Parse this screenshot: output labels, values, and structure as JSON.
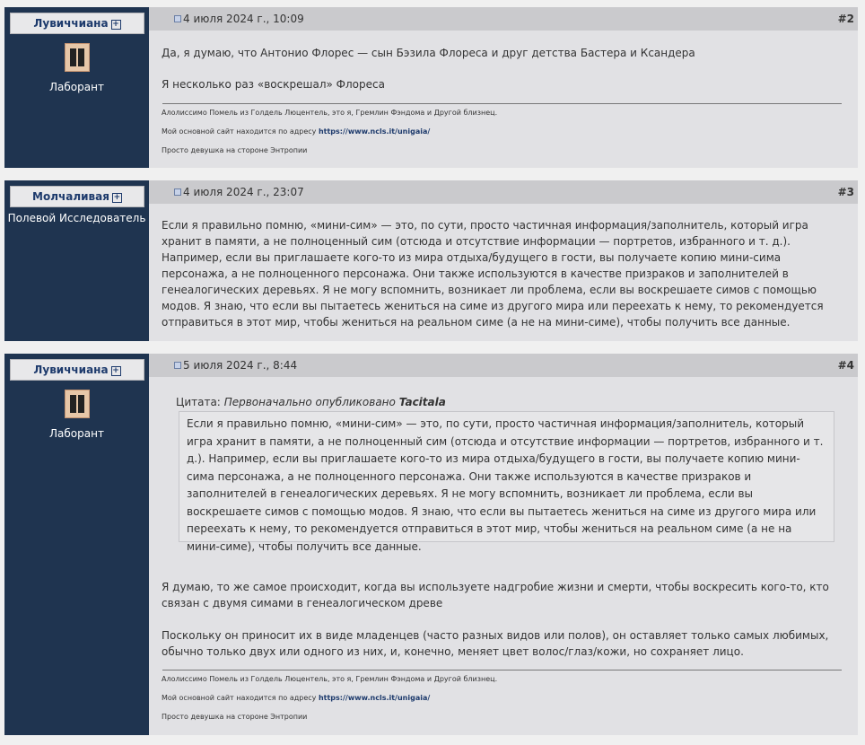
{
  "posts": [
    {
      "user": "Лувиччиана",
      "title": "Лаборант",
      "date": "4 июля 2024 г., 10:09",
      "number": "#2",
      "paragraphs": [
        "Да, я думаю, что Антонио Флорес — сын Бэзила Флореса и друг детства Бастера и Ксандера",
        "Я несколько раз «воскрешал» Флореса"
      ],
      "signature": {
        "line1": "Алолиссимо Помель из Голдель Люцентель, это я, Гремлин Фэндома и Другой близнец.",
        "line2_prefix": "Мой основной сайт находится по адресу",
        "line2_link": "https://www.ncls.it/unigaia/",
        "line3": "Просто девушка на стороне Энтропии"
      }
    },
    {
      "user": "Молчаливая",
      "title": "Полевой Исследователь",
      "date": "4 июля 2024 г., 23:07",
      "number": "#3",
      "paragraphs": [
        "Если я правильно помню, «мини-сим» — это, по сути, просто частичная информация/заполнитель, который игра хранит в памяти, а не полноценный сим (отсюда и отсутствие информации — портретов, избранного и т. д.). Например, если вы приглашаете кого-то из мира отдыха/будущего в гости, вы получаете копию мини-сима персонажа, а не полноценного персонажа. Они также используются в качестве призраков и заполнителей в генеалогических деревьях. Я не могу вспомнить, возникает ли проблема, если вы воскрешаете симов с помощью модов. Я знаю, что если вы пытаетесь жениться на симе из другого мира или переехать к нему, то рекомендуется отправиться в этот мир, чтобы жениться на реальном симе (а не на мини-симе), чтобы получить все данные."
      ]
    },
    {
      "user": "Лувиччиана",
      "title": "Лаборант",
      "date": "5 июля 2024 г., 8:44",
      "number": "#4",
      "quote_prefix": "Цитата:",
      "quote_by": "Первоначально опубликовано",
      "quote_author": "Tacitala",
      "quote_text": "Если я правильно помню, «мини-сим» — это, по сути, просто частичная информация/заполнитель, который игра хранит в памяти, а не полноценный сим (отсюда и отсутствие информации — портретов, избранного и т. д.). Например, если вы приглашаете кого-то из мира отдыха/будущего в гости, вы получаете копию мини-сима персонажа, а не полноценного персонажа. Они также используются в качестве призраков и заполнителей в генеалогических деревьях. Я не могу вспомнить, возникает ли проблема, если вы воскрешаете симов с помощью модов. Я знаю, что если вы пытаетесь жениться на симе из другого мира или переехать к нему, то рекомендуется отправиться в этот мир, чтобы жениться на реальном симе (а не на мини-симе), чтобы получить все данные.",
      "paragraphs": [
        "Я думаю, то же самое происходит, когда вы используете надгробие жизни и смерти, чтобы воскресить кого-то, кто связан с двумя симами в генеалогическом древе",
        "Поскольку он приносит их в виде младенцев (часто разных видов или полов), он оставляет только самых любимых, обычно только двух или одного из них, и, конечно, меняет цвет волос/глаз/кожи, но сохраняет лицо."
      ],
      "signature": {
        "line1": "Алолиссимо Помель из Голдель Люцентель, это я, Гремлин Фэндома и Другой близнец.",
        "line2_prefix": "Мой основной сайт находится по адресу",
        "line2_link": "https://www.ncls.it/unigaia/",
        "line3": "Просто девушка на стороне Энтропии"
      }
    }
  ],
  "icons": [
    "plus-icon",
    "post-icon"
  ],
  "colors": {
    "sidebar": "#1f3450",
    "post_bg": "#e1e1e4",
    "header_bg": "#cacacd",
    "username": "#1d3a6c"
  }
}
